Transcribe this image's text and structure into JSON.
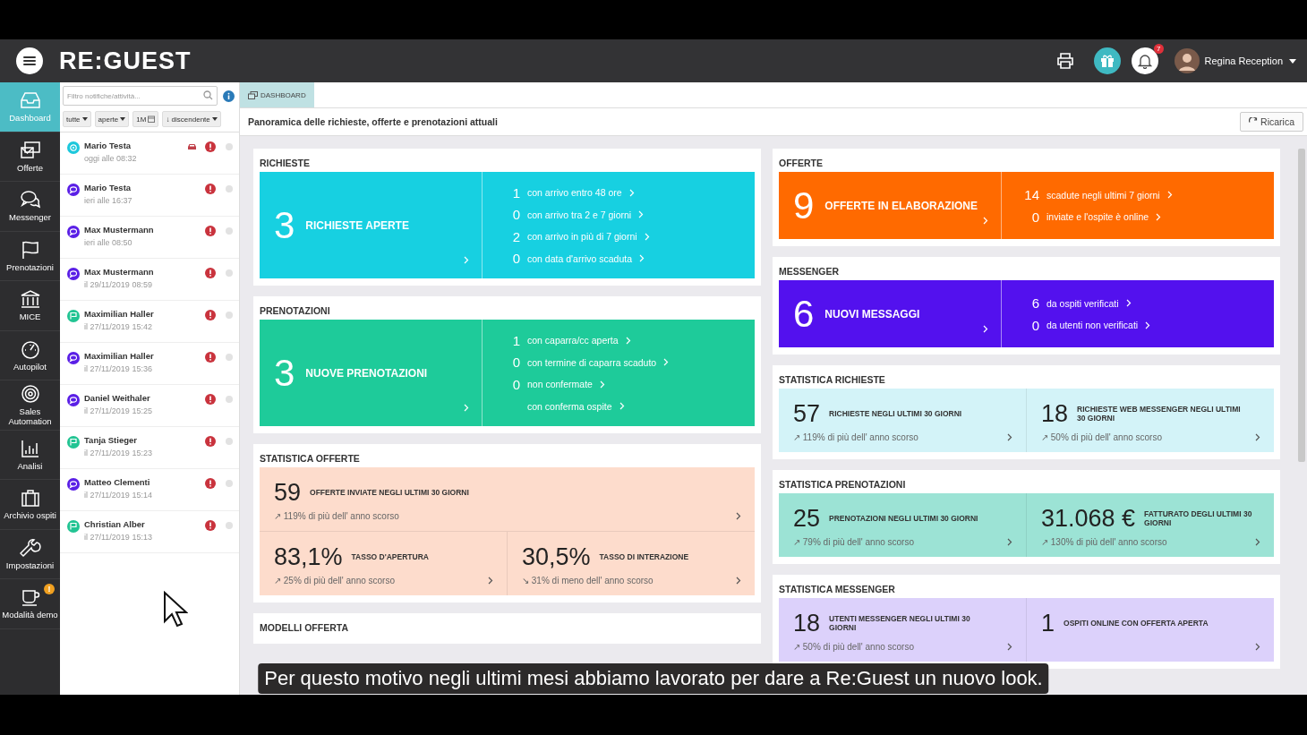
{
  "header": {
    "logo": "RE:GUEST",
    "notification_count": "7",
    "user_name": "Regina Reception"
  },
  "nav": [
    {
      "label": "Dashboard",
      "selected": true
    },
    {
      "label": "Offerte",
      "selected": false
    },
    {
      "label": "Messenger",
      "selected": false
    },
    {
      "label": "Prenotazioni",
      "selected": false
    },
    {
      "label": "MICE",
      "selected": false
    },
    {
      "label": "Autopilot",
      "selected": false
    },
    {
      "label": "Sales Automation",
      "selected": false
    },
    {
      "label": "Analisi",
      "selected": false
    },
    {
      "label": "Archivio ospiti",
      "selected": false
    },
    {
      "label": "Impostazioni",
      "selected": false
    },
    {
      "label": "Modalità demo",
      "selected": false,
      "badge": "!"
    }
  ],
  "notifications_panel": {
    "search_placeholder": "Filtro notifiche/attività...",
    "filters": [
      {
        "label": "tutte",
        "kind": "dropdown"
      },
      {
        "label": "aperte",
        "kind": "dropdown"
      },
      {
        "label": "1M",
        "kind": "date"
      },
      {
        "label": "↓ discendente",
        "kind": "dropdown"
      }
    ],
    "items": [
      {
        "kind": "request",
        "name": "Mario Testa",
        "time": "oggi alle 08:32",
        "car": true
      },
      {
        "kind": "message",
        "name": "Mario Testa",
        "time": "ieri alle 16:37",
        "car": false
      },
      {
        "kind": "message",
        "name": "Max Mustermann",
        "time": "ieri alle 08:50",
        "car": false
      },
      {
        "kind": "message",
        "name": "Max Mustermann",
        "time": "il 29/11/2019 08:59",
        "car": false
      },
      {
        "kind": "booking",
        "name": "Maximilian Haller",
        "time": "il 27/11/2019 15:42",
        "car": false
      },
      {
        "kind": "message",
        "name": "Maximilian Haller",
        "time": "il 27/11/2019 15:36",
        "car": false
      },
      {
        "kind": "message",
        "name": "Daniel Weithaler",
        "time": "il 27/11/2019 15:25",
        "car": false
      },
      {
        "kind": "booking",
        "name": "Tanja Stieger",
        "time": "il 27/11/2019 15:23",
        "car": false
      },
      {
        "kind": "message",
        "name": "Matteo Clementi",
        "time": "il 27/11/2019 15:14",
        "car": false
      },
      {
        "kind": "booking",
        "name": "Christian Alber",
        "time": "il 27/11/2019 15:13",
        "car": false
      }
    ]
  },
  "tabs": [
    {
      "label": "DASHBOARD",
      "selected": true
    }
  ],
  "page_title": "Panoramica delle richieste, offerte e prenotazioni attuali",
  "reload_button": "Ricarica",
  "columns": [
    {
      "cards": [
        {
          "title": "RICHIESTE",
          "kind": "summary",
          "color": "#17d0e1",
          "count": "3",
          "label": "RICHIESTE APERTE",
          "details": [
            {
              "count": "1",
              "text": "con arrivo entro 48 ore"
            },
            {
              "count": "0",
              "text": "con arrivo tra 2 e 7 giorni"
            },
            {
              "count": "2",
              "text": "con arrivo in più di 7 giorni"
            },
            {
              "count": "0",
              "text": "con data d'arrivo scaduta"
            }
          ]
        },
        {
          "title": "PRENOTAZIONI",
          "kind": "summary",
          "color": "#1ecb9a",
          "count": "3",
          "label": "NUOVE PRENOTAZIONI",
          "details": [
            {
              "count": "1",
              "text": "con caparra/cc aperta"
            },
            {
              "count": "0",
              "text": "con termine di caparra scaduto"
            },
            {
              "count": "0",
              "text": "non confermate"
            },
            {
              "text": "con conferma ospite"
            }
          ]
        },
        {
          "title": "STATISTICA OFFERTE",
          "kind": "stats",
          "color": "#fddccc",
          "rows": [
            {
              "cells": [
                {
                  "value": "59",
                  "label": "OFFERTE INVIATE NEGLI ULTIMI 30 GIORNI",
                  "trend": "↗ 119% di più dell' anno scorso"
                }
              ]
            },
            {
              "cells": [
                {
                  "value": "83,1%",
                  "label": "TASSO D'APERTURA",
                  "trend": "↗ 25% di più dell' anno scorso"
                },
                {
                  "value": "30,5%",
                  "label": "TASSO DI INTERAZIONE",
                  "trend": "↘ 31% di meno dell' anno scorso"
                }
              ]
            }
          ]
        },
        {
          "title": "MODELLI OFFERTA",
          "kind": "empty"
        }
      ]
    },
    {
      "cards": [
        {
          "title": "OFFERTE",
          "kind": "summary",
          "color": "#ff6a00",
          "count": "9",
          "label": "OFFERTE IN ELABORAZIONE",
          "details": [
            {
              "count": "14",
              "text": "scadute negli ultimi 7 giorni"
            },
            {
              "count": "0",
              "text": "inviate e l'ospite è online"
            }
          ]
        },
        {
          "title": "MESSENGER",
          "kind": "summary",
          "color": "#5311ee",
          "count": "6",
          "label": "NUOVI MESSAGGI",
          "details": [
            {
              "count": "6",
              "text": "da ospiti verificati"
            },
            {
              "count": "0",
              "text": "da utenti non verificati"
            }
          ]
        },
        {
          "title": "STATISTICA RICHIESTE",
          "kind": "stats",
          "color": "#d3f3f8",
          "rows": [
            {
              "cells": [
                {
                  "value": "57",
                  "label": "RICHIESTE NEGLI ULTIMI 30 GIORNI",
                  "trend": "↗ 119% di più dell' anno scorso"
                },
                {
                  "value": "18",
                  "label": "RICHIESTE WEB MESSENGER NEGLI ULTIMI 30 GIORNI",
                  "trend": "↗ 50% di più dell' anno scorso"
                }
              ]
            }
          ]
        },
        {
          "title": "STATISTICA PRENOTAZIONI",
          "kind": "stats",
          "color": "#9ce3d5",
          "rows": [
            {
              "cells": [
                {
                  "value": "25",
                  "label": "PRENOTAZIONI NEGLI ULTIMI 30 GIORNI",
                  "trend": "↗ 79% di più dell' anno scorso"
                },
                {
                  "value": "31.068 €",
                  "label": "FATTURATO DEGLI ULTIMI 30 GIORNI",
                  "trend": "↗ 130% di più dell' anno scorso"
                }
              ]
            }
          ]
        },
        {
          "title": "STATISTICA MESSENGER",
          "kind": "stats",
          "color": "#dcd1fb",
          "rows": [
            {
              "cells": [
                {
                  "value": "18",
                  "label": "UTENTI MESSENGER NEGLI ULTIMI 30 GIORNI",
                  "trend": "↗ 50% di più dell' anno scorso"
                },
                {
                  "value": "1",
                  "label": "OSPITI ONLINE CON OFFERTA APERTA"
                }
              ]
            }
          ]
        }
      ]
    }
  ],
  "subtitle": "Per questo motivo negli ultimi mesi abbiamo lavorato per dare a Re:Guest un nuovo look."
}
